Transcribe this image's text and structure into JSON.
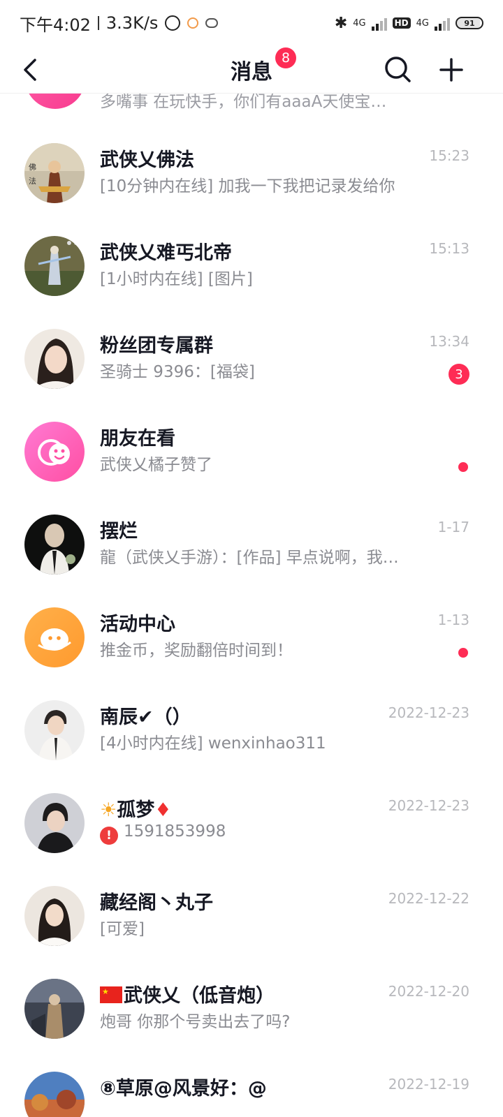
{
  "status_bar": {
    "time": "下午4:02",
    "speed": "3.3K/s",
    "network1": "4G",
    "hd": "HD",
    "network2": "4G",
    "battery": "91"
  },
  "nav": {
    "title": "消息",
    "badge": "8"
  },
  "partial_item": {
    "preview": "多嘴事 在玩快手，你们有aaaA天使宝…"
  },
  "messages": [
    {
      "name": "武侠乂佛法",
      "preview": "[10分钟内在线] 加我一下我把记录发给你",
      "time": "15:23"
    },
    {
      "name": "武侠乂难丐北帝",
      "preview": "[1小时内在线] [图片]",
      "time": "15:13"
    },
    {
      "name": "粉丝团专属群",
      "preview": "圣骑士 9396：[福袋]",
      "time": "13:34",
      "unread": "3"
    },
    {
      "name": "朋友在看",
      "preview": "武侠乂橘子赞了"
    },
    {
      "name": "摆烂",
      "preview": "龍（武侠乂手游）：[作品] 早点说啊，我…",
      "time": "1-17"
    },
    {
      "name": "活动中心",
      "preview": "推金币，奖励翻倍时间到！",
      "time": "1-13"
    },
    {
      "name": "南辰✔（）",
      "preview": "[4小时内在线] wenxinhao311",
      "time": "2022-12-23"
    },
    {
      "name": "孤梦",
      "preview": "1591853998",
      "time": "2022-12-23"
    },
    {
      "name": "藏经阁丶丸子",
      "preview": "[可爱]",
      "time": "2022-12-22"
    },
    {
      "name": "武侠乂（低音炮）",
      "preview": "炮哥 你那个号卖出去了吗?",
      "time": "2022-12-20"
    },
    {
      "name": "⑧草原@风景好：@",
      "time": "2022-12-19"
    }
  ],
  "icons": {
    "sun": "☀",
    "diamond": "♦",
    "alert": "!"
  },
  "colors": {
    "accent": "#fe2c55",
    "text_primary": "#161823",
    "text_secondary": "#8a8b91",
    "text_time": "#b7b8bc"
  }
}
